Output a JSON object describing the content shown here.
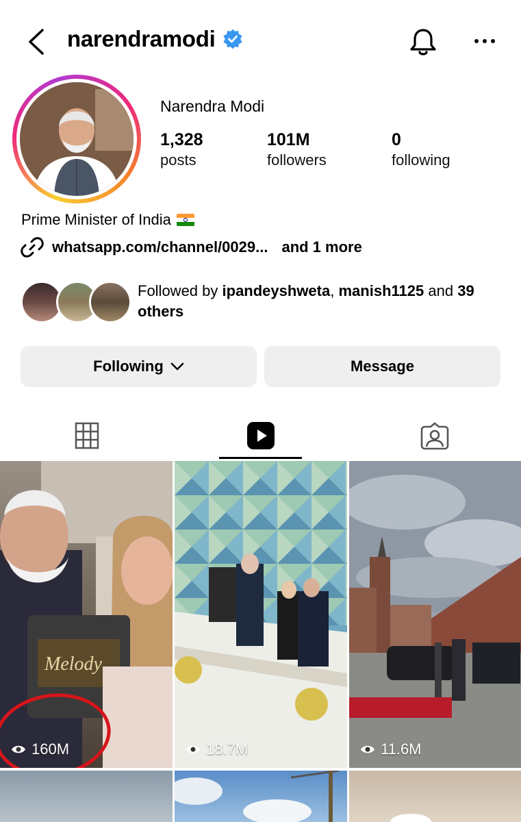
{
  "header": {
    "username": "narendramodi",
    "verified": true
  },
  "profile": {
    "display_name": "Narendra Modi",
    "stats": [
      {
        "value": "1,328",
        "label": "posts"
      },
      {
        "value": "101M",
        "label": "followers"
      },
      {
        "value": "0",
        "label": "following"
      }
    ],
    "bio": "Prime Minister of India",
    "link_text": "whatsapp.com/channel/0029...",
    "link_more": "and 1 more",
    "followed_by": {
      "prefix": "Followed by",
      "user1": "ipandeyshweta",
      "sep": ",",
      "user2": "manish1125",
      "mid": "and",
      "count": "39",
      "suffix": "others"
    }
  },
  "actions": {
    "following_label": "Following",
    "message_label": "Message"
  },
  "tabs": [
    {
      "name": "grid-icon",
      "active": false
    },
    {
      "name": "reels-icon",
      "active": true
    },
    {
      "name": "tagged-icon",
      "active": false
    }
  ],
  "reels": [
    {
      "views": "160M"
    },
    {
      "views": "18.7M"
    },
    {
      "views": "11.6M"
    }
  ],
  "colors": {
    "verified_blue": "#3897f0",
    "button_bg": "#efefef",
    "annotation_red": "#d8141b"
  }
}
